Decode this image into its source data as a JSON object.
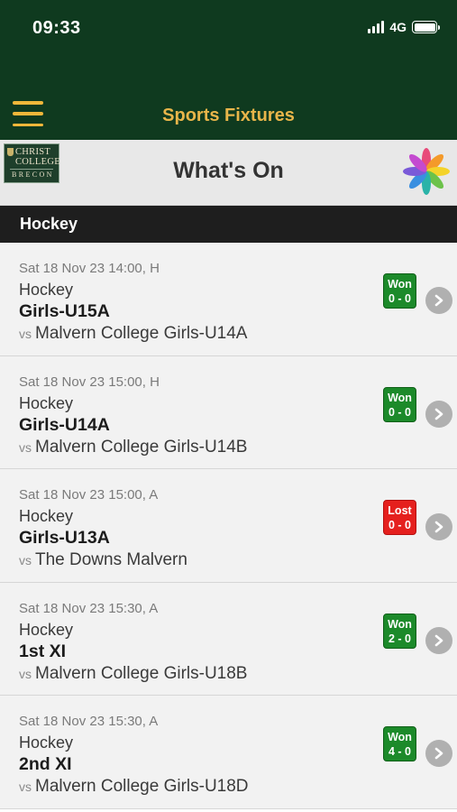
{
  "status_bar": {
    "time": "09:33",
    "network": "4G"
  },
  "nav": {
    "title": "Sports Fixtures"
  },
  "header": {
    "title": "What's On",
    "crest": {
      "line1": "CHRIST",
      "line2": "COLLEGE",
      "line3": "BRECON"
    }
  },
  "section": {
    "title": "Hockey"
  },
  "fixtures": [
    {
      "date": "Sat 18 Nov 23 14:00, H",
      "sport": "Hockey",
      "team": "Girls-U15A",
      "vs": "vs",
      "opponent": "Malvern College Girls-U14A",
      "result": "Won",
      "score": "0 - 0"
    },
    {
      "date": "Sat 18 Nov 23 15:00, H",
      "sport": "Hockey",
      "team": "Girls-U14A",
      "vs": "vs",
      "opponent": "Malvern College Girls-U14B",
      "result": "Won",
      "score": "0 - 0"
    },
    {
      "date": "Sat 18 Nov 23 15:00, A",
      "sport": "Hockey",
      "team": "Girls-U13A",
      "vs": "vs",
      "opponent": "The Downs Malvern",
      "result": "Lost",
      "score": "0 - 0"
    },
    {
      "date": "Sat 18 Nov 23 15:30, A",
      "sport": "Hockey",
      "team": "1st XI",
      "vs": "vs",
      "opponent": "Malvern College Girls-U18B",
      "result": "Won",
      "score": "2 - 0"
    },
    {
      "date": "Sat 18 Nov 23 15:30, A",
      "sport": "Hockey",
      "team": "2nd XI",
      "vs": "vs",
      "opponent": "Malvern College Girls-U18D",
      "result": "Won",
      "score": "4 - 0"
    }
  ],
  "colors": {
    "header_green": "#0f3a1f",
    "accent_gold": "#e8b54a",
    "won": "#1c8a2a",
    "lost": "#e5201e"
  },
  "icons": {
    "menu": "hamburger-menu-icon",
    "logo": "pinwheel-logo-icon",
    "row": "chevron-right-icon"
  }
}
